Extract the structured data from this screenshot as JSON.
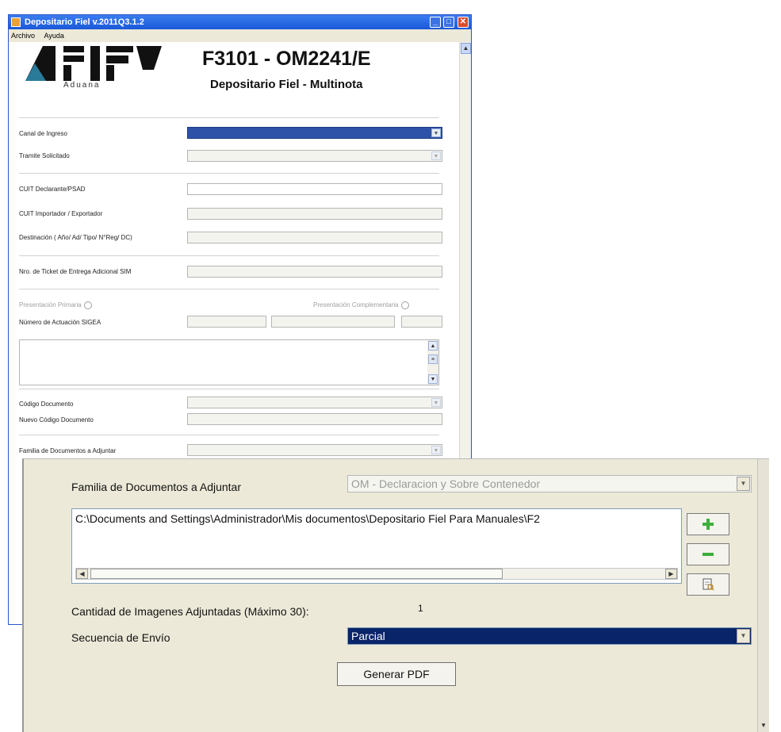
{
  "window": {
    "title": "Depositario Fiel v.2011Q3.1.2",
    "menu": [
      "Archivo",
      "Ayuda"
    ]
  },
  "logo": {
    "text": "AFIP",
    "sub": "Aduana"
  },
  "form": {
    "title": "F3101 - OM2241/E",
    "subtitle": "Depositario Fiel - Multinota",
    "fields": {
      "canal": "Canal de Ingreso",
      "tramite": "Tramite Solicitado",
      "cuit_decl": "CUIT Declarante/PSAD",
      "cuit_imp": "CUIT Importador / Exportador",
      "destinacion": "Destinación ( Año/  Ad/ Tipo/ N°Reg/ DC)",
      "ticket": "Nro. de Ticket de Entrega Adicional SIM",
      "presentacion_primaria": "Presentación Primaria",
      "presentacion_complementaria": "Presentación Complementaria",
      "numero_actuacion": "Número de Actuación SIGEA",
      "codigo_doc": "Código Documento",
      "nuevo_codigo": "Nuevo Código Documento",
      "familia": "Familia de Documentos a Adjuntar"
    }
  },
  "panel": {
    "familia_label": "Familia de Documentos a Adjuntar",
    "familia_value": "OM - Declaracion y Sobre Contenedor",
    "file_path": "C:\\Documents and Settings\\Administrador\\Mis documentos\\Depositario Fiel Para Manuales\\F2",
    "cantidad_label": "Cantidad de Imagenes Adjuntadas (Máximo 30):",
    "cantidad_value": "1",
    "secuencia_label": "Secuencia de Envío",
    "secuencia_value": "Parcial",
    "generar_button": "Generar PDF"
  },
  "colors": {
    "titlebar": "#1a58d8",
    "panel_bg": "#ece9d8",
    "selection": "#0a246a",
    "add_icon": "#3cae3c",
    "remove_icon": "#3cae3c"
  }
}
